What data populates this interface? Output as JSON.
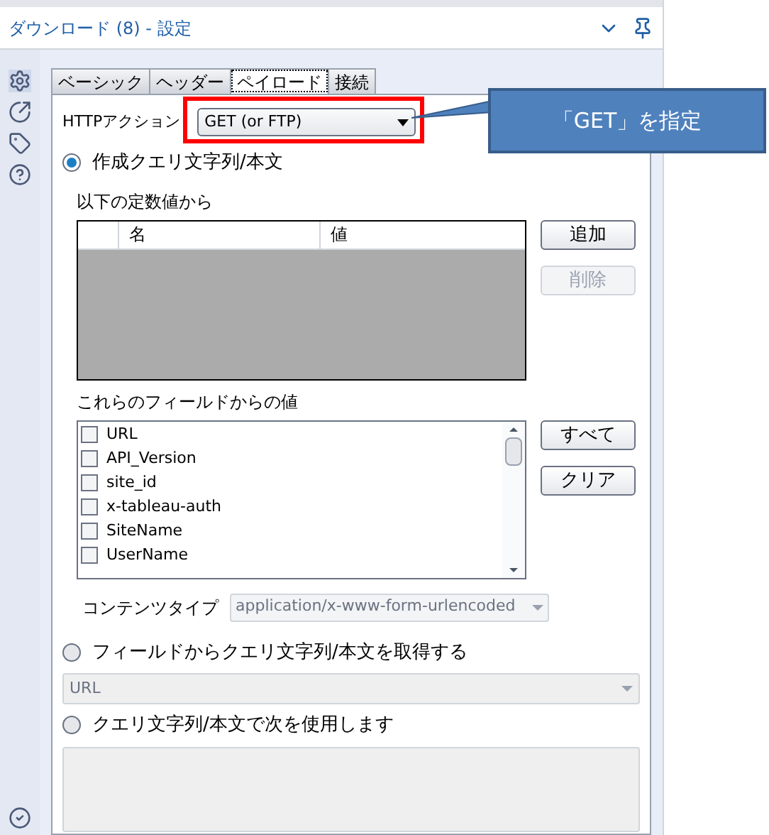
{
  "title": "ダウンロード (8) - 設定",
  "tabs": [
    {
      "label": "ベーシック",
      "selected": false
    },
    {
      "label": "ヘッダー",
      "selected": false
    },
    {
      "label": "ペイロード",
      "selected": true
    },
    {
      "label": "接続",
      "selected": false
    }
  ],
  "http_action": {
    "label": "HTTPアクション",
    "value": "GET (or FTP)"
  },
  "callout": {
    "text": "「GET」を指定"
  },
  "options": [
    {
      "label": "作成クエリ文字列/本文",
      "selected": true
    },
    {
      "label": "フィールドからクエリ文字列/本文を取得する",
      "selected": false
    },
    {
      "label": "クエリ文字列/本文で次を使用します",
      "selected": false
    }
  ],
  "constants": {
    "label": "以下の定数値から",
    "columns": [
      "名",
      "値"
    ],
    "buttons": [
      {
        "label": "追加",
        "disabled": false
      },
      {
        "label": "削除",
        "disabled": true
      }
    ]
  },
  "fields": {
    "label": "これらのフィールドからの値",
    "items": [
      {
        "label": "URL",
        "checked": false
      },
      {
        "label": "API_Version",
        "checked": false
      },
      {
        "label": "site_id",
        "checked": false
      },
      {
        "label": "x-tableau-auth",
        "checked": false
      },
      {
        "label": "SiteName",
        "checked": false
      },
      {
        "label": "UserName",
        "checked": false
      }
    ],
    "buttons": [
      {
        "label": "すべて",
        "disabled": false
      },
      {
        "label": "クリア",
        "disabled": false
      }
    ]
  },
  "content_type": {
    "label": "コンテンツタイプ",
    "value": "application/x-www-form-urlencoded",
    "disabled": true
  },
  "field_select": {
    "value": "URL",
    "disabled": true
  }
}
